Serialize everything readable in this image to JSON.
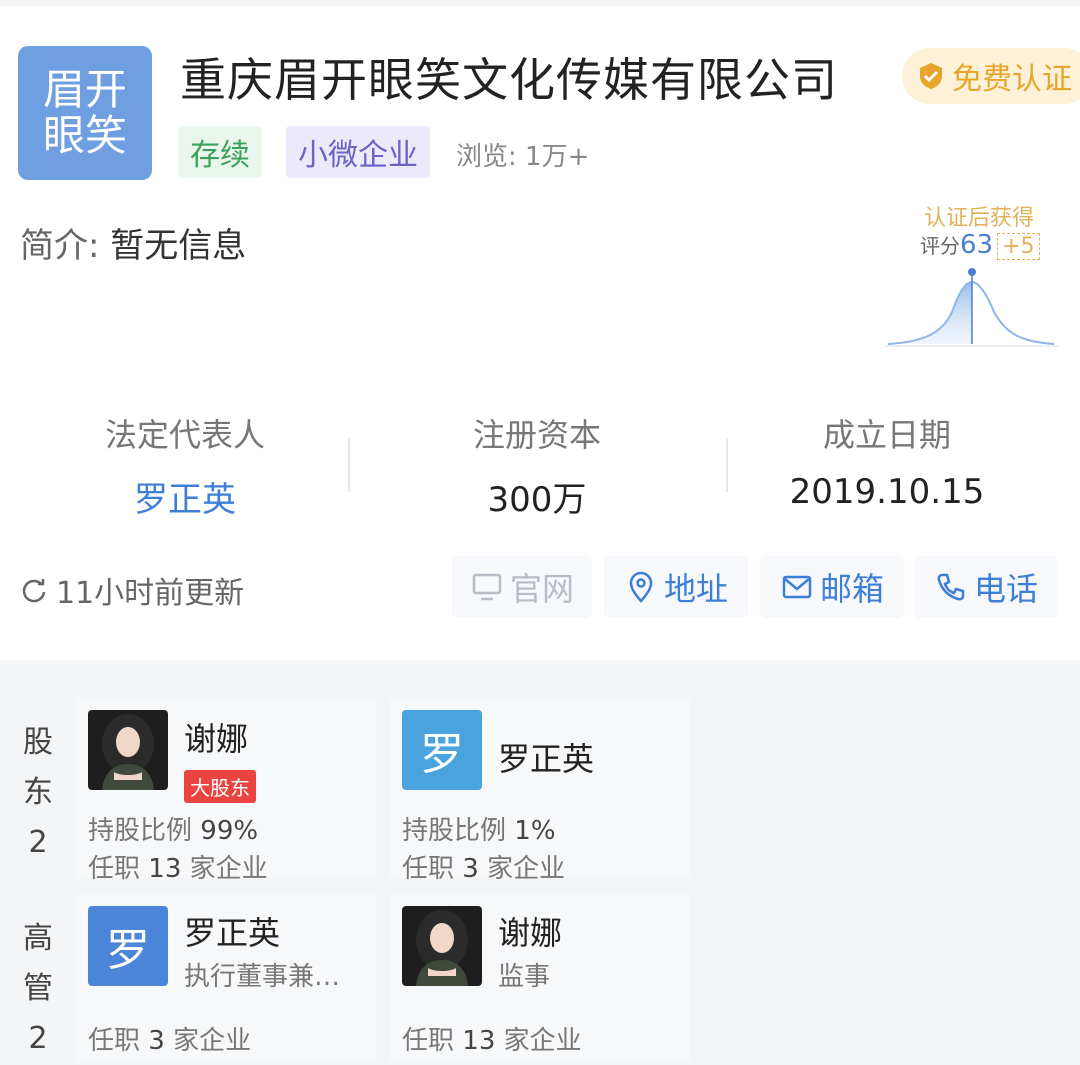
{
  "company": {
    "logo_line1": "眉开",
    "logo_line2": "眼笑",
    "name": "重庆眉开眼笑文化传媒有限公司",
    "verify_label": "免费认证",
    "status_tag": "存续",
    "size_tag": "小微企业",
    "views": "浏览: 1万+",
    "intro_label": "简介:",
    "intro_value": "暂无信息"
  },
  "score": {
    "hint": "认证后获得",
    "label": "评分",
    "value": "63",
    "bonus": "+5"
  },
  "stats": [
    {
      "key": "法定代表人",
      "value": "罗正英"
    },
    {
      "key": "注册资本",
      "value": "300万"
    },
    {
      "key": "成立日期",
      "value": "2019.10.15"
    }
  ],
  "update_text": "11小时前更新",
  "actions": [
    {
      "label": "官网",
      "icon": "monitor-icon",
      "enabled": false
    },
    {
      "label": "地址",
      "icon": "location-pin-icon",
      "enabled": true
    },
    {
      "label": "邮箱",
      "icon": "mail-icon",
      "enabled": true
    },
    {
      "label": "电话",
      "icon": "phone-icon",
      "enabled": true
    }
  ],
  "shareholders": {
    "label": [
      "股",
      "东",
      "2"
    ],
    "items": [
      {
        "name": "谢娜",
        "badge": "大股东",
        "ratio_label": "持股比例",
        "ratio": "99%",
        "jobs_prefix": "任职",
        "jobs_count": "13",
        "jobs_suffix": "家企业",
        "avatar": "photo"
      },
      {
        "name": "罗正英",
        "avatar_letter": "罗",
        "avatar_color": "#4aa3df",
        "ratio_label": "持股比例",
        "ratio": "1%",
        "jobs_prefix": "任职",
        "jobs_count": "3",
        "jobs_suffix": "家企业"
      }
    ]
  },
  "executives": {
    "label": [
      "高",
      "管",
      "2"
    ],
    "items": [
      {
        "name": "罗正英",
        "avatar_letter": "罗",
        "avatar_color": "#4d86d8",
        "role": "执行董事兼…",
        "jobs_prefix": "任职",
        "jobs_count": "3",
        "jobs_suffix": "家企业"
      },
      {
        "name": "谢娜",
        "avatar": "photo",
        "role": "监事",
        "jobs_prefix": "任职",
        "jobs_count": "13",
        "jobs_suffix": "家企业"
      }
    ]
  }
}
